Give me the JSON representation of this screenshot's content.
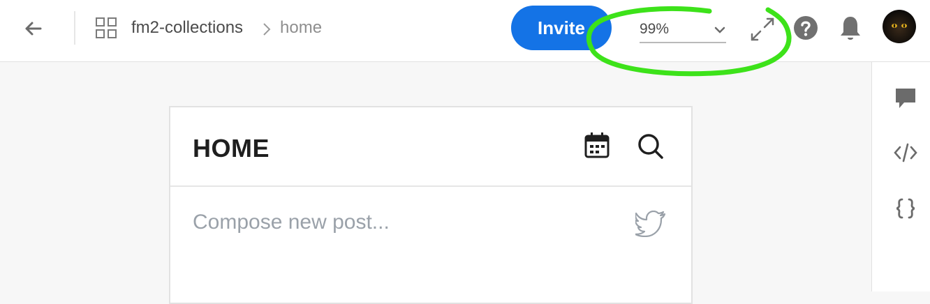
{
  "topbar": {
    "project_name": "fm2-collections",
    "page_name": "home",
    "invite_label": "Invite",
    "zoom_value": "99%"
  },
  "card": {
    "title": "HOME",
    "compose_placeholder": "Compose new post..."
  },
  "icons": {
    "back": "arrow-left-icon",
    "apps": "grid-icon",
    "breadcrumb_separator": "chevron-right-icon",
    "zoom_dropdown": "chevron-down-icon",
    "fullscreen": "expand-icon",
    "help": "help-circle-icon",
    "notifications": "bell-icon",
    "comments": "comment-icon",
    "code": "code-icon",
    "json": "braces-icon",
    "calendar": "calendar-icon",
    "search": "search-icon",
    "twitter": "twitter-icon"
  },
  "colors": {
    "invite_button": "#1473e6",
    "annotation_highlight": "#3de21a",
    "icon_gray": "#707070",
    "placeholder_text": "#9aa1a9"
  }
}
